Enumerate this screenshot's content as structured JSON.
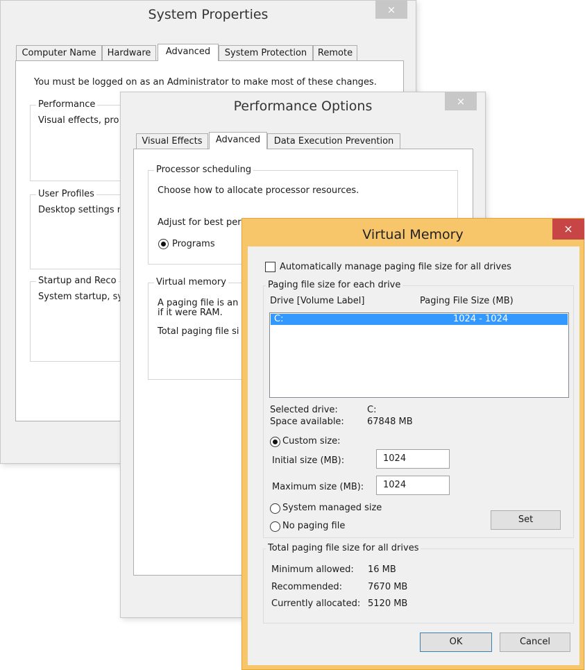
{
  "system_properties": {
    "title": "System Properties",
    "close_glyph": "×",
    "tabs": [
      "Computer Name",
      "Hardware",
      "Advanced",
      "System Protection",
      "Remote"
    ],
    "admin_notice": "You must be logged on as an Administrator to make most of these changes.",
    "performance": {
      "legend": "Performance",
      "text": "Visual effects, pro"
    },
    "user_profiles": {
      "legend": "User Profiles",
      "text": "Desktop settings r"
    },
    "startup": {
      "legend": "Startup and Reco",
      "text": "System startup, sy"
    }
  },
  "performance_options": {
    "title": "Performance Options",
    "close_glyph": "×",
    "tabs": [
      "Visual Effects",
      "Advanced",
      "Data Execution Prevention"
    ],
    "processor_scheduling": {
      "legend": "Processor scheduling",
      "description": "Choose how to allocate processor resources.",
      "adjust_text": "Adjust for best per",
      "programs_label": "Programs"
    },
    "virtual_memory": {
      "legend": "Virtual memory",
      "line1": "A paging file is an",
      "line2": "if it were RAM.",
      "total_text": "Total paging file si"
    }
  },
  "virtual_memory": {
    "title": "Virtual Memory",
    "close_glyph": "×",
    "auto_manage_label": "Automatically manage paging file size for all drives",
    "auto_manage_checked": false,
    "paging_group_legend": "Paging file size for each drive",
    "col_drive": "Drive  [Volume Label]",
    "col_size": "Paging File Size (MB)",
    "drives": [
      {
        "drive": "C:",
        "size": "1024 - 1024"
      }
    ],
    "selected_drive_label": "Selected drive:",
    "selected_drive_value": "C:",
    "space_available_label": "Space available:",
    "space_available_value": "67848 MB",
    "custom_size_label": "Custom size:",
    "initial_size_label": "Initial size (MB):",
    "initial_size_value": "1024",
    "maximum_size_label": "Maximum size (MB):",
    "maximum_size_value": "1024",
    "system_managed_label": "System managed size",
    "no_paging_label": "No paging file",
    "set_label": "Set",
    "totals_legend": "Total paging file size for all drives",
    "minimum_label": "Minimum allowed:",
    "minimum_value": "16 MB",
    "recommended_label": "Recommended:",
    "recommended_value": "7670 MB",
    "allocated_label": "Currently allocated:",
    "allocated_value": "5120 MB",
    "ok_label": "OK",
    "cancel_label": "Cancel"
  }
}
